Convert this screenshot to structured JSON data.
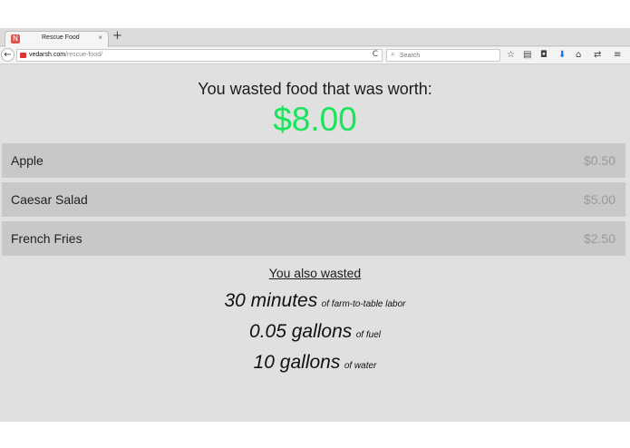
{
  "browser": {
    "tab_title": "Rescue Food",
    "tab_close": "×",
    "favicon_letter": "N",
    "new_tab": "+",
    "url_domain": "vedarsh.com",
    "url_path": "/rescue-food/",
    "search_placeholder": "Search",
    "back_glyph": "←",
    "reload_glyph": "C",
    "icons": [
      "back-icon",
      "reload-icon",
      "search-icon",
      "star-icon",
      "clipboard-icon",
      "pocket-icon",
      "download-icon",
      "home-icon",
      "sync-icon",
      "menu-icon"
    ]
  },
  "page": {
    "headline": "You wasted food that was worth:",
    "total": "$8.00",
    "total_color": "#19e55a",
    "items": [
      {
        "name": "Apple",
        "price": "$0.50"
      },
      {
        "name": "Caesar Salad",
        "price": "$5.00"
      },
      {
        "name": "French Fries",
        "price": "$2.50"
      }
    ],
    "also_heading": "You also wasted",
    "stats": [
      {
        "value": "30 minutes",
        "unit": "of farm-to-table labor"
      },
      {
        "value": "0.05 gallons",
        "unit": "of fuel"
      },
      {
        "value": "10 gallons",
        "unit": "of water"
      }
    ]
  }
}
